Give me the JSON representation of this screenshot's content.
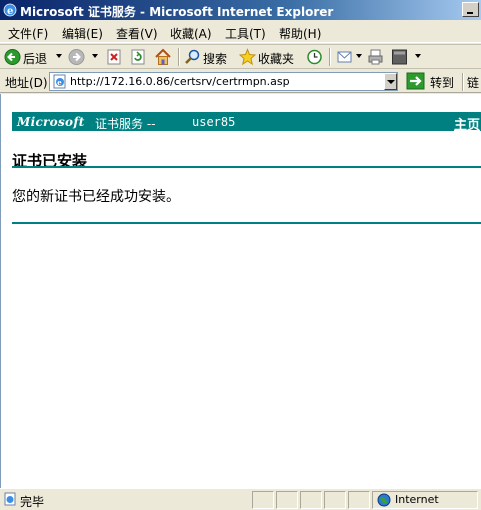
{
  "window": {
    "title": "Microsoft 证书服务 - Microsoft Internet Explorer"
  },
  "menu": {
    "items": [
      "文件(F)",
      "编辑(E)",
      "查看(V)",
      "收藏(A)",
      "工具(T)",
      "帮助(H)"
    ]
  },
  "toolbar": {
    "back_label": "后退",
    "search_label": "搜索",
    "favorites_label": "收藏夹"
  },
  "address": {
    "label": "地址(D)",
    "url": "http://172.16.0.86/certsrv/certrmpn.asp",
    "go_label": "转到",
    "links_label": "链"
  },
  "page": {
    "banner": {
      "logo": "Microsoft",
      "service": "证书服务  --",
      "user": "user85",
      "home_link": "主页"
    },
    "heading": "证书已安装",
    "message": "您的新证书已经成功安装。"
  },
  "status": {
    "text": "完毕",
    "zone": "Internet"
  },
  "colors": {
    "banner": "#008080",
    "titlebar": "#0a246a",
    "chrome": "#ece9d8"
  }
}
